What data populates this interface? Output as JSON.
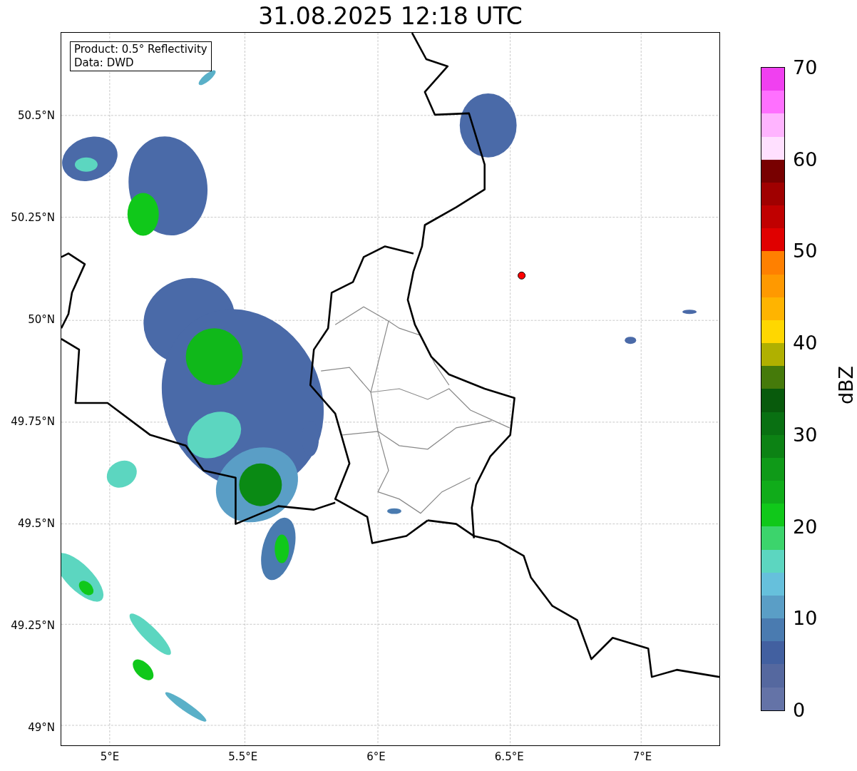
{
  "title": "31.08.2025 12:18 UTC",
  "info_box": [
    "Product: 0.5° Reflectivity",
    "Data: DWD"
  ],
  "map": {
    "x_ticks": [
      "5°E",
      "5.5°E",
      "6°E",
      "6.5°E",
      "7°E"
    ],
    "y_ticks": [
      "50.5°N",
      "50.25°N",
      "50°N",
      "49.75°N",
      "49.5°N",
      "49.25°N",
      "49°N"
    ]
  },
  "colorbar": {
    "label": "dBZ",
    "ticks": [
      "70",
      "60",
      "50",
      "40",
      "30",
      "20",
      "10",
      "0"
    ],
    "bins": [
      {
        "color": "#f040f0"
      },
      {
        "color": "#ff70ff"
      },
      {
        "color": "#ffb4ff"
      },
      {
        "color": "#ffe0ff"
      },
      {
        "color": "#780000"
      },
      {
        "color": "#a00000"
      },
      {
        "color": "#c00000"
      },
      {
        "color": "#e00000"
      },
      {
        "color": "#ff8000"
      },
      {
        "color": "#ff9900"
      },
      {
        "color": "#ffb400"
      },
      {
        "color": "#ffd700"
      },
      {
        "color": "#b0b000"
      },
      {
        "color": "#457a0a"
      },
      {
        "color": "#085a0c"
      },
      {
        "color": "#097012"
      },
      {
        "color": "#0c8214"
      },
      {
        "color": "#0f9a18"
      },
      {
        "color": "#10ac1a"
      },
      {
        "color": "#10c81a"
      },
      {
        "color": "#3cd46c"
      },
      {
        "color": "#5cd6c0"
      },
      {
        "color": "#66c0dc"
      },
      {
        "color": "#5a9ec6"
      },
      {
        "color": "#4a7bb0"
      },
      {
        "color": "#4260a0"
      },
      {
        "color": "#55689f"
      },
      {
        "color": "#6473a7"
      }
    ]
  }
}
